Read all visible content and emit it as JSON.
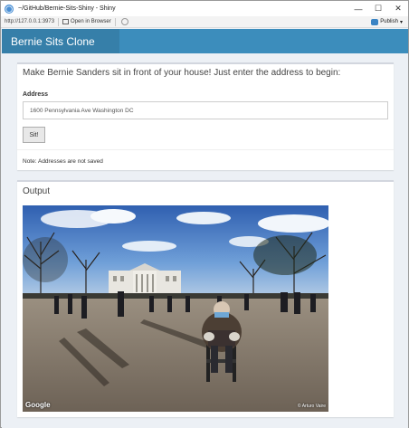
{
  "window": {
    "title": "~/GitHub/Bernie-Sits-Shiny - Shiny",
    "minimize": "—",
    "maximize": "☐",
    "close": "✕"
  },
  "toolbar": {
    "url": "http://127.0.0.1:3973",
    "open_in_browser": "Open in Browser",
    "publish": "Publish"
  },
  "navbar": {
    "brand": "Bernie Sits Clone"
  },
  "input_box": {
    "heading": "Make Bernie Sanders sit in front of your house! Just enter the address to begin:",
    "address_label": "Address",
    "address_value": "1600 Pennsylvania Ave Washington DC",
    "button_label": "Sit!",
    "note": "Note: Addresses are not saved"
  },
  "output_box": {
    "heading": "Output",
    "image_credit_left": "Google",
    "image_credit_right": "© Arturo Vaire"
  }
}
